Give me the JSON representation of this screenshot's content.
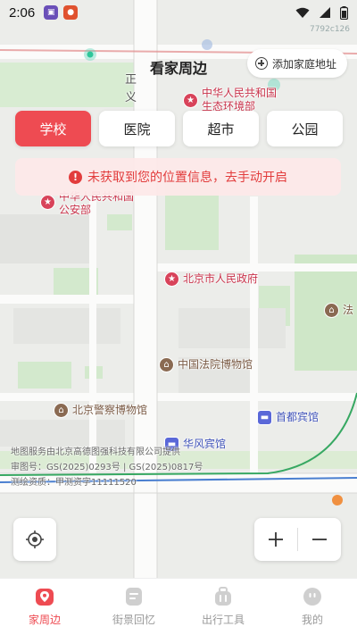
{
  "status_bar": {
    "time": "2:06",
    "code": "7792c126"
  },
  "header": {
    "title": "看家周边",
    "add_home_label": "添加家庭地址"
  },
  "categories": [
    {
      "label": "学校",
      "active": true
    },
    {
      "label": "医院",
      "active": false
    },
    {
      "label": "超市",
      "active": false
    },
    {
      "label": "公园",
      "active": false
    }
  ],
  "warning": {
    "text": "未获取到您的位置信息，去手动开启"
  },
  "map": {
    "labels": {
      "env_1": "中华人民共和国",
      "env_2": "生态环境部",
      "police_1": "中华人民共和国",
      "police_2": "公安部",
      "gov": "北京市人民政府",
      "court_museum": "中国法院博物馆",
      "police_museum": "北京警察博物馆",
      "capital_hotel": "首都宾馆",
      "huafeng_hotel": "华风宾馆",
      "fa": "法",
      "street_1": "正",
      "street_2": "义"
    },
    "attribution": {
      "line1": "地图服务由北京高德图强科技有限公司提供",
      "line2": "审图号：GS(2025)0293号 | GS(2025)0817号",
      "line3": "测绘资质：甲测资字11111520"
    }
  },
  "tabs": [
    {
      "label": "家周边",
      "active": true
    },
    {
      "label": "街景回忆",
      "active": false
    },
    {
      "label": "出行工具",
      "active": false
    },
    {
      "label": "我的",
      "active": false
    }
  ],
  "colors": {
    "accent": "#EE4B52",
    "warning_bg": "#FDE9E9",
    "warning_text": "#E23C3C"
  }
}
